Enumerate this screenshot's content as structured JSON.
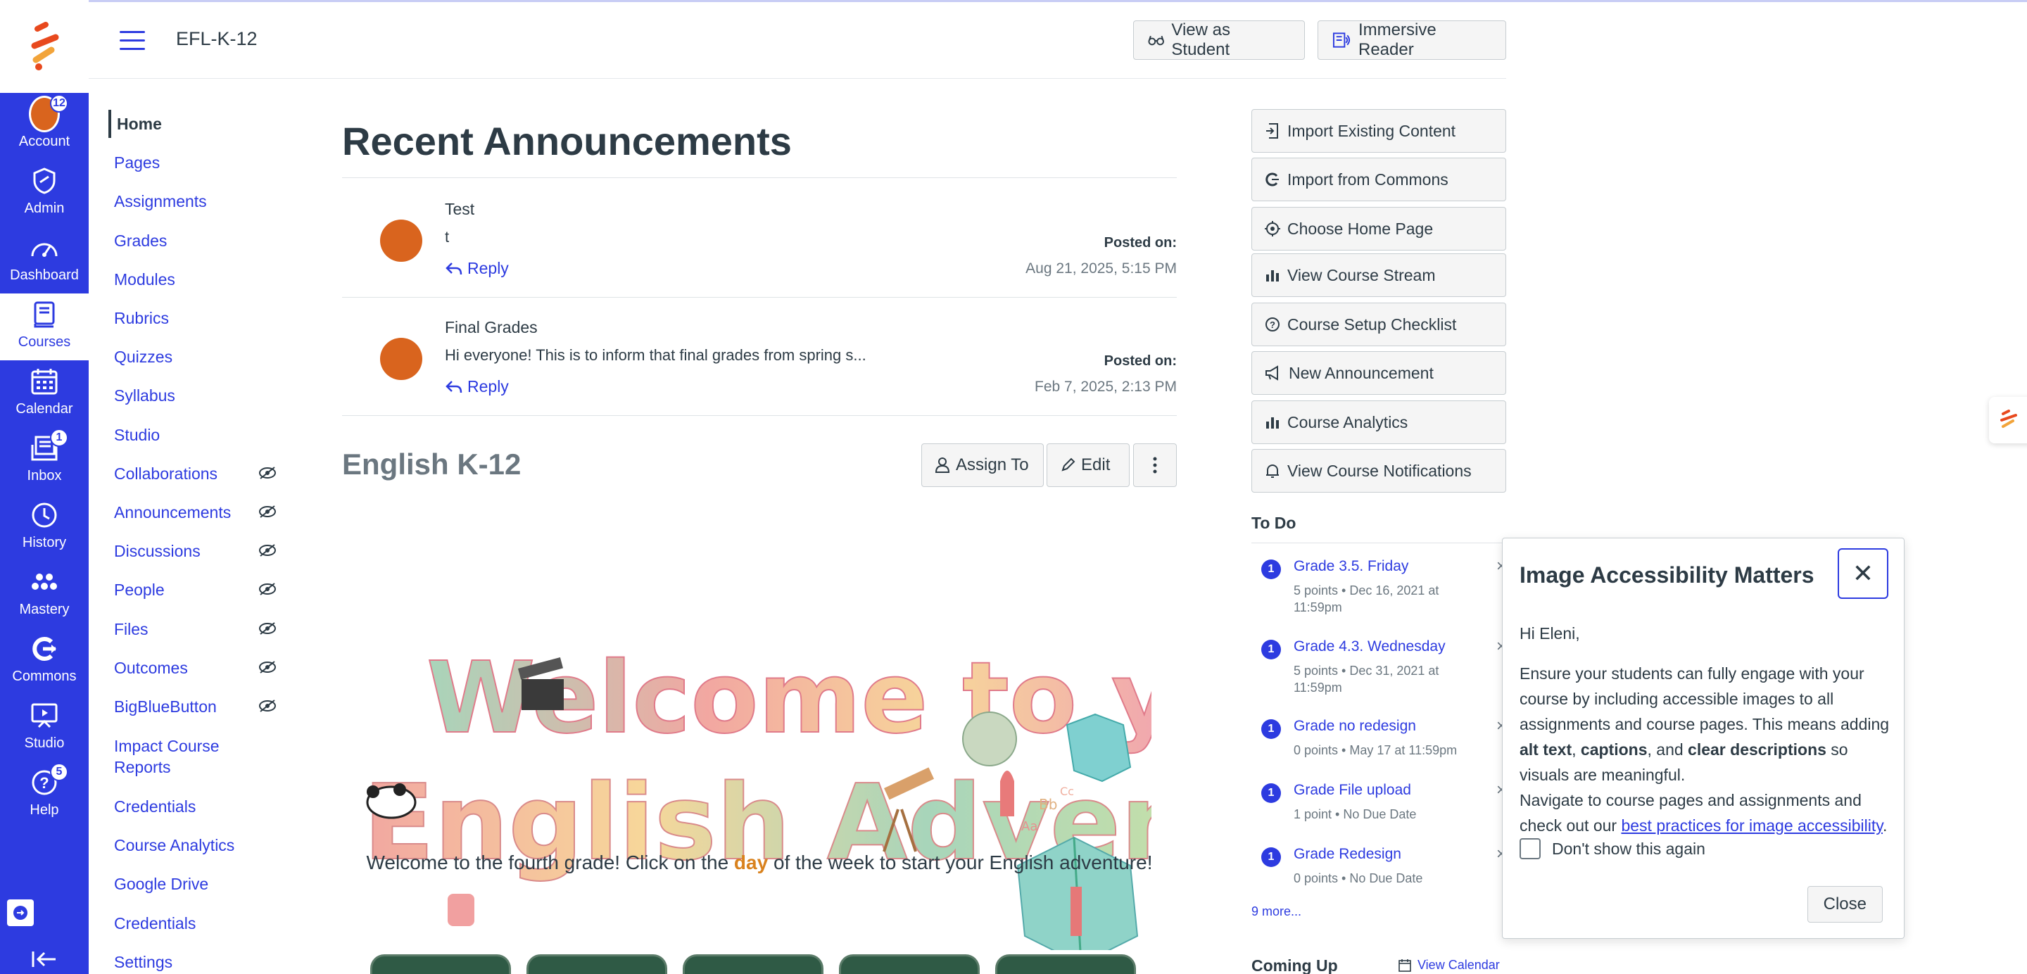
{
  "header": {
    "course_title": "EFL-K-12",
    "view_as_student": "View as Student",
    "immersive_reader": "Immersive Reader"
  },
  "global_nav": {
    "items": [
      {
        "label": "Account",
        "icon": "avatar",
        "badge": "12"
      },
      {
        "label": "Admin",
        "icon": "shield-icon"
      },
      {
        "label": "Dashboard",
        "icon": "dashboard-icon"
      },
      {
        "label": "Courses",
        "icon": "book-icon"
      },
      {
        "label": "Calendar",
        "icon": "calendar-icon"
      },
      {
        "label": "Inbox",
        "icon": "inbox-icon",
        "badge": "1"
      },
      {
        "label": "History",
        "icon": "clock-icon"
      },
      {
        "label": "Mastery",
        "icon": "mastery-icon"
      },
      {
        "label": "Commons",
        "icon": "commons-icon"
      },
      {
        "label": "Studio",
        "icon": "studio-icon"
      },
      {
        "label": "Help",
        "icon": "help-icon",
        "badge": "5"
      }
    ],
    "active": "Courses"
  },
  "course_nav": {
    "items": [
      {
        "label": "Home",
        "hidden": false
      },
      {
        "label": "Pages",
        "hidden": false
      },
      {
        "label": "Assignments",
        "hidden": false
      },
      {
        "label": "Grades",
        "hidden": false
      },
      {
        "label": "Modules",
        "hidden": false
      },
      {
        "label": "Rubrics",
        "hidden": false
      },
      {
        "label": "Quizzes",
        "hidden": false
      },
      {
        "label": "Syllabus",
        "hidden": false
      },
      {
        "label": "Studio",
        "hidden": false
      },
      {
        "label": "Collaborations",
        "hidden": true
      },
      {
        "label": "Announcements",
        "hidden": true
      },
      {
        "label": "Discussions",
        "hidden": true
      },
      {
        "label": "People",
        "hidden": true
      },
      {
        "label": "Files",
        "hidden": true
      },
      {
        "label": "Outcomes",
        "hidden": true
      },
      {
        "label": "BigBlueButton",
        "hidden": true
      },
      {
        "label": "Impact Course",
        "label2": "Reports",
        "hidden": false
      },
      {
        "label": "Credentials",
        "hidden": false
      },
      {
        "label": "Course Analytics",
        "hidden": false
      },
      {
        "label": "Google Drive",
        "hidden": false
      },
      {
        "label": "Credentials",
        "hidden": false
      },
      {
        "label": "Settings",
        "hidden": false
      }
    ],
    "active": "Home"
  },
  "main": {
    "recent_heading": "Recent Announcements",
    "announcements": [
      {
        "title": "Test",
        "body": "t",
        "reply": "Reply",
        "posted_label": "Posted on:",
        "date": "Aug 21, 2025, 5:15 PM"
      },
      {
        "title": "Final Grades",
        "body": "Hi everyone! This is to inform that final grades from spring s...",
        "reply": "Reply",
        "posted_label": "Posted on:",
        "date": "Feb 7, 2025, 2:13 PM"
      }
    ],
    "page_title": "English K-12",
    "assign_to": "Assign To",
    "edit": "Edit",
    "banner_line1": "Welcome to your",
    "banner_line2": "English Adventure!",
    "welcome_pre": "Welcome to the fourth grade! Click on the ",
    "welcome_day": "day",
    "welcome_post": " of the week to start your English adventure!"
  },
  "sidebar": {
    "buttons": [
      {
        "label": "Import Existing Content",
        "icon": "import-icon"
      },
      {
        "label": "Import from Commons",
        "icon": "commons-icon"
      },
      {
        "label": "Choose Home Page",
        "icon": "target-icon"
      },
      {
        "label": "View Course Stream",
        "icon": "bar-chart-icon"
      },
      {
        "label": "Course Setup Checklist",
        "icon": "question-icon"
      },
      {
        "label": "New Announcement",
        "icon": "megaphone-icon"
      },
      {
        "label": "Course Analytics",
        "icon": "bar-chart-icon"
      },
      {
        "label": "View Course Notifications",
        "icon": "bell-icon"
      }
    ],
    "todo_heading": "To Do",
    "todo": [
      {
        "count": "1",
        "title": "Grade 3.5. Friday",
        "meta": "5 points • Dec 16, 2021 at 11:59pm"
      },
      {
        "count": "1",
        "title": "Grade 4.3. Wednesday",
        "meta": "5 points • Dec 31, 2021 at 11:59pm"
      },
      {
        "count": "1",
        "title": "Grade no redesign",
        "meta": "0 points • May 17 at 11:59pm"
      },
      {
        "count": "1",
        "title": "Grade File upload",
        "meta": "1 point • No Due Date"
      },
      {
        "count": "1",
        "title": "Grade Redesign",
        "meta": "0 points • No Due Date"
      }
    ],
    "more": "9 more...",
    "coming_up": "Coming Up",
    "view_calendar": "View Calendar"
  },
  "modal": {
    "title": "Image Accessibility Matters",
    "greeting": "Hi Eleni,",
    "p1_a": "Ensure your students can fully engage with your course by including accessible images to all assignments and course pages. This means adding ",
    "p1_b1": "alt text",
    "p1_sep1": ", ",
    "p1_b2": "captions",
    "p1_sep2": ", and ",
    "p1_b3": "clear descriptions",
    "p1_c": " so visuals are meaningful.",
    "p2_a": "Navigate to course pages and assignments and check out our ",
    "p2_link": "best practices for image accessibility",
    "p2_end": ".",
    "dont_show": "Don't show this again",
    "close": "Close",
    "close_x": "✕"
  },
  "colors": {
    "brand": "#2d3be0",
    "nav_bg": "#2d3be0",
    "avatar": "#d9641e",
    "text": "#2d3b45"
  }
}
